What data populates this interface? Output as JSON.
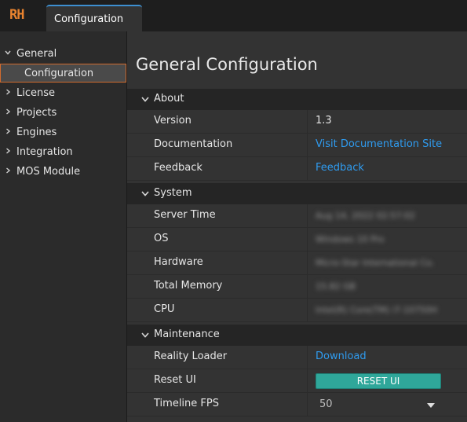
{
  "app": {
    "logo_text": "RH",
    "logo_color": "#e8832f",
    "accent": "#3d8fd1"
  },
  "tabs": [
    {
      "label": "Configuration"
    }
  ],
  "sidebar": {
    "items": [
      {
        "label": "General",
        "expanded": true,
        "children": [
          {
            "label": "Configuration",
            "selected": true
          }
        ]
      },
      {
        "label": "License"
      },
      {
        "label": "Projects"
      },
      {
        "label": "Engines"
      },
      {
        "label": "Integration"
      },
      {
        "label": "MOS Module"
      }
    ]
  },
  "main": {
    "title": "General Configuration",
    "sections": [
      {
        "label": "About",
        "rows": [
          {
            "key": "Version",
            "value": "1.3"
          },
          {
            "key": "Documentation",
            "value": "Visit Documentation Site"
          },
          {
            "key": "Feedback",
            "value": "Feedback"
          }
        ]
      },
      {
        "label": "System",
        "rows": [
          {
            "key": "Server Time",
            "value": "Aug 14, 2022 02:57:02"
          },
          {
            "key": "OS",
            "value": "Windows 10 Pro"
          },
          {
            "key": "Hardware",
            "value": "Micro-Star International Co."
          },
          {
            "key": "Total Memory",
            "value": "15.82 GB"
          },
          {
            "key": "CPU",
            "value": "Intel(R) Core(TM) i7-10750H"
          }
        ]
      },
      {
        "label": "Maintenance",
        "rows": [
          {
            "key": "Reality Loader",
            "value": "Download"
          },
          {
            "key": "Reset UI",
            "value": "RESET UI"
          },
          {
            "key": "Timeline FPS",
            "value": "50"
          }
        ]
      }
    ]
  },
  "colors": {
    "link": "#2f9bef",
    "button": "#2fa79a",
    "selected_border": "#d06a2e"
  }
}
